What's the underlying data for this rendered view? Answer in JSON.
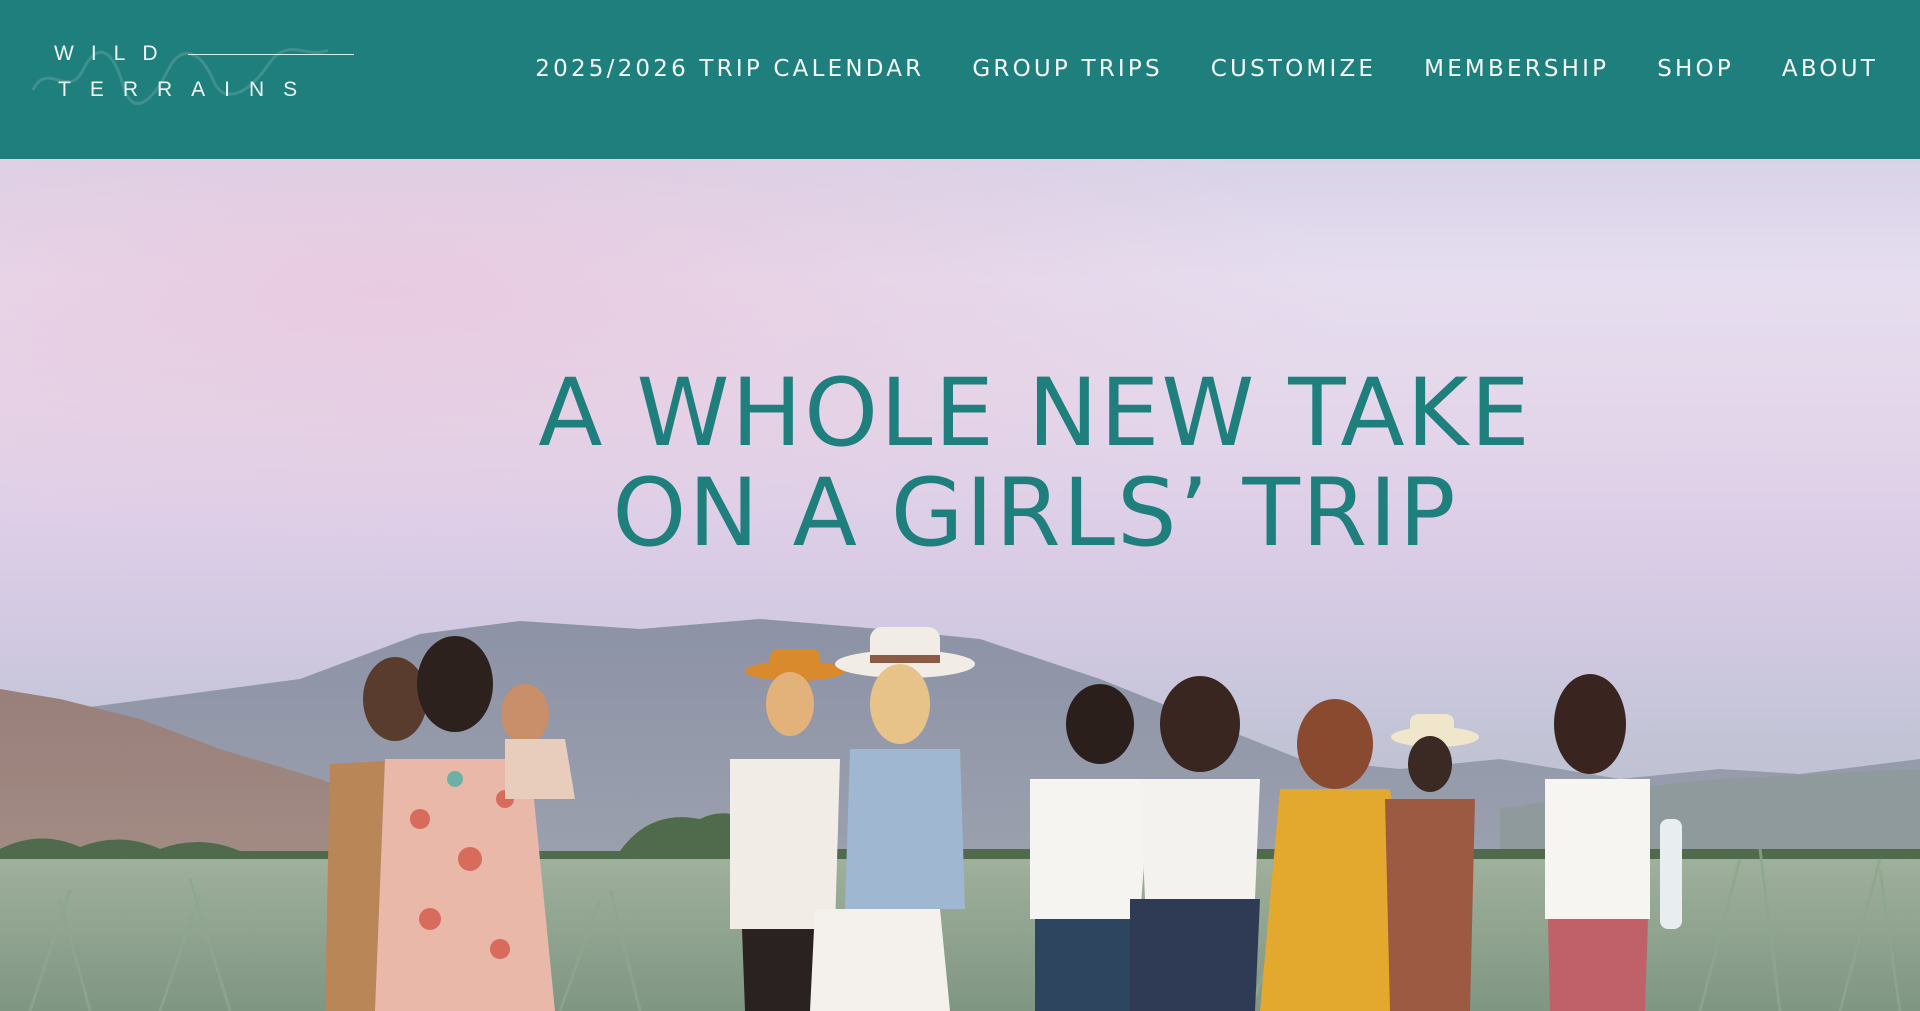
{
  "brand": {
    "line1": "WILD",
    "line2": "TERRAINS",
    "colors": {
      "teal": "#1f7f7c",
      "header_text": "#f4faf9"
    }
  },
  "nav": {
    "items": [
      {
        "label": "2025/2026 TRIP CALENDAR"
      },
      {
        "label": "GROUP TRIPS"
      },
      {
        "label": "CUSTOMIZE"
      },
      {
        "label": "MEMBERSHIP"
      },
      {
        "label": "SHOP"
      },
      {
        "label": "ABOUT"
      }
    ]
  },
  "hero": {
    "title_line1": "A WHOLE NEW TAKE",
    "title_line2": "ON A GIRLS’ TRIP",
    "image_icon": "photo-group-women-agave-field"
  }
}
